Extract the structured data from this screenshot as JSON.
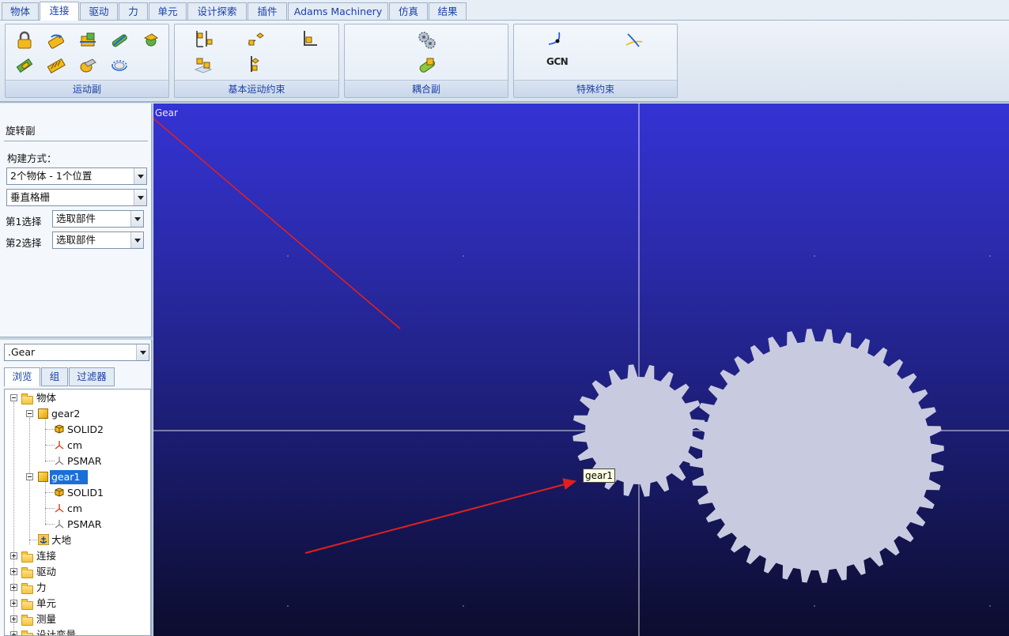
{
  "tabs": [
    {
      "label": "物体"
    },
    {
      "label": "连接"
    },
    {
      "label": "驱动"
    },
    {
      "label": "力"
    },
    {
      "label": "单元"
    },
    {
      "label": "设计探索"
    },
    {
      "label": "插件"
    },
    {
      "label": "Adams Machinery"
    },
    {
      "label": "仿真"
    },
    {
      "label": "结果"
    }
  ],
  "active_tab": "连接",
  "ribbon": {
    "groups": [
      {
        "label": "运动副"
      },
      {
        "label": "基本运动约束"
      },
      {
        "label": "耦合副"
      },
      {
        "label": "特殊约束"
      }
    ],
    "gcon_label": "GCN"
  },
  "panel": {
    "title": "旋转副",
    "build_label": "构建方式：",
    "build_method": "2个物体 - 1个位置",
    "orientation": "垂直格栅",
    "first_label": "第1选择",
    "first_value": "选取部件",
    "second_label": "第2选择",
    "second_value": "选取部件"
  },
  "browser": {
    "model": ".Gear",
    "tabs": [
      {
        "label": "浏览"
      },
      {
        "label": "组"
      },
      {
        "label": "过滤器"
      }
    ],
    "tree": {
      "bodies": "物体",
      "gear2": "gear2",
      "solid2": "SOLID2",
      "cm2": "cm",
      "psmar2": "PSMAR",
      "gear1": "gear1",
      "solid1": "SOLID1",
      "cm1": "cm",
      "psmar1": "PSMAR",
      "ground": "大地",
      "connections": "连接",
      "motions": "驱动",
      "forces": "力",
      "elements": "单元",
      "measures": "测量",
      "design_vars": "设计变量"
    }
  },
  "viewport": {
    "title": "Gear",
    "tooltip": "gear1",
    "gear_color": "#c8cbdf"
  },
  "colors": {
    "accent_text": "#1a3fa8",
    "annotation_arrow": "#e02020",
    "selection": "#1a6fd8"
  }
}
